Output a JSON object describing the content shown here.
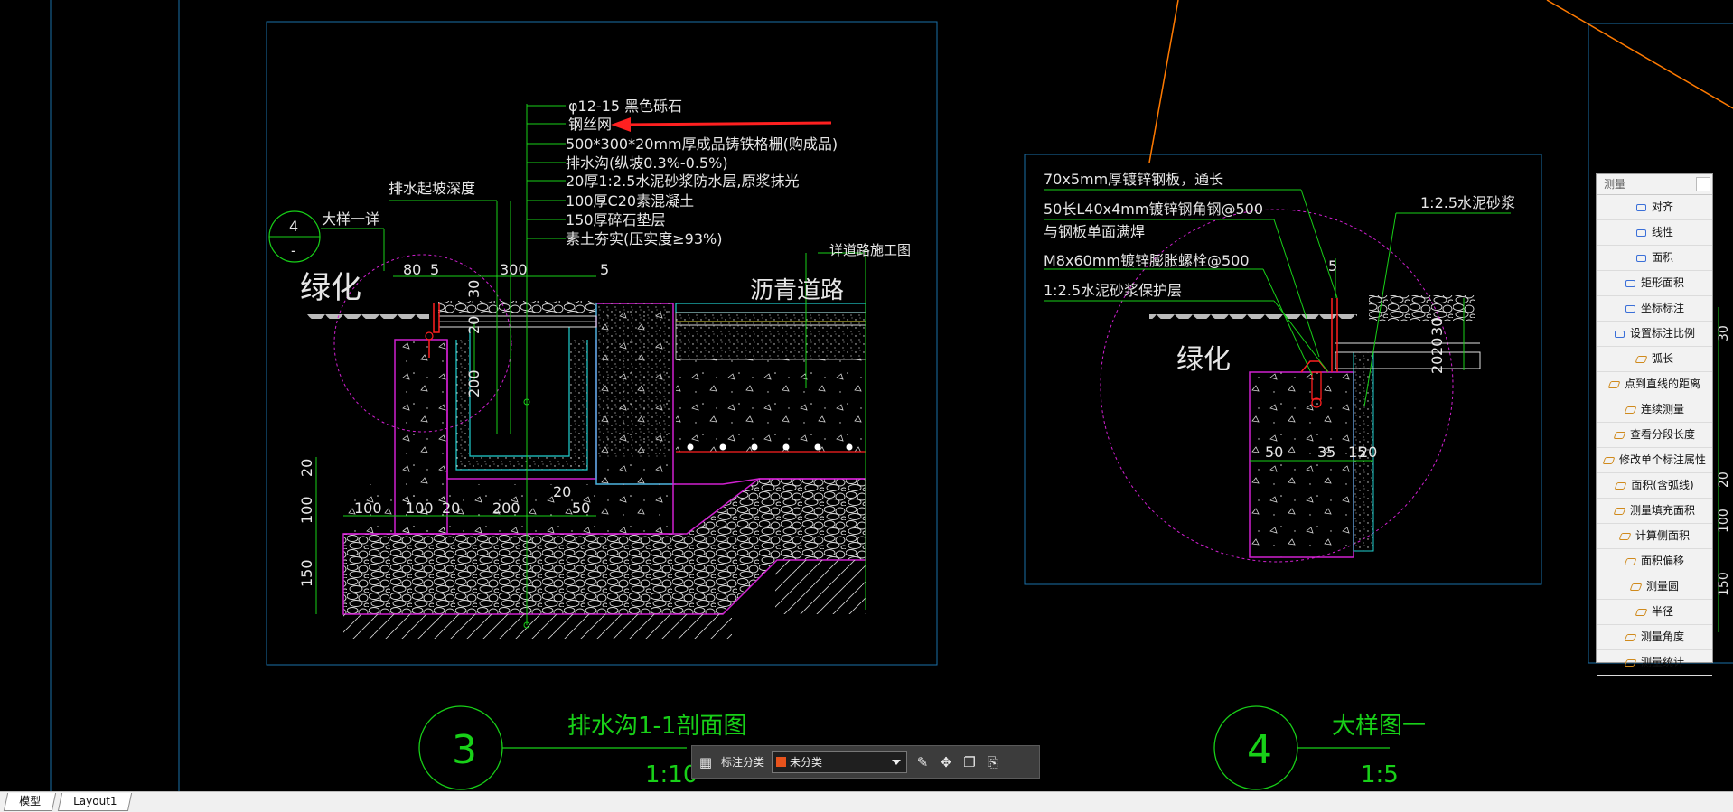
{
  "drawing": {
    "left": {
      "mat_notes": [
        "φ12-15 黑色砾石",
        "钢丝网",
        "500*300*20mm厚成品铸铁格栅(购成品)",
        "排水沟(纵坡0.3%-0.5%)",
        "20厚1:2.5水泥砂浆防水层,原浆抹光",
        "100厚C20素混凝土",
        "150厚碎石垫层",
        "素土夯实(压实度≥93%)"
      ],
      "drain_depth": "排水起坡深度",
      "detail_label": "大样一详",
      "detail_num": "4",
      "detail_dash": "-",
      "green": "绿化",
      "asphalt": "沥青道路",
      "road_ref": "详道路施工图",
      "dims": {
        "d80": "80",
        "d5a": "5",
        "d300": "300",
        "d5b": "5",
        "v30": "30",
        "v20": "20",
        "v200": "200",
        "h100a": "100",
        "h100b": "100",
        "h20a": "20",
        "h200": "200",
        "h20b": "20",
        "h50": "50",
        "l20": "20",
        "l100": "100",
        "l150": "150"
      },
      "title": "排水沟1-1剖面图",
      "scale": "1:10",
      "circle_num": "3"
    },
    "right": {
      "notes": [
        "70x5mm厚镀锌钢板，通长",
        "50长L40x4mm镀锌钢角钢@500",
        "与钢板单面满焊",
        "M8x60mm镀锌膨胀螺栓@500",
        "1:2.5水泥砂浆保护层"
      ],
      "mortar": "1:2.5水泥砂浆",
      "green": "绿化",
      "dims": {
        "t5": "5",
        "v30": "30",
        "v20a": "20",
        "v20b": "20",
        "b50": "50",
        "b35": "35",
        "b15": "15",
        "b20": "20"
      },
      "title": "大样图一",
      "scale": "1:5",
      "circle_num": "4"
    },
    "edge_dims": [
      "30",
      "20",
      "100",
      "150"
    ]
  },
  "measure_panel": {
    "title": "测量",
    "items": [
      "对齐",
      "线性",
      "面积",
      "矩形面积",
      "坐标标注",
      "设置标注比例",
      "弧长",
      "点到直线的距离",
      "连续测量",
      "查看分段长度",
      "修改单个标注属性",
      "面积(含弧线)",
      "测量填充面积",
      "计算侧面积",
      "面积偏移",
      "测量圆",
      "半径",
      "测量角度",
      "测量统计"
    ]
  },
  "toolbar": {
    "label": "标注分类",
    "value": "未分类",
    "swatch_color": "#e8531c"
  },
  "tabs": [
    "模型",
    "Layout1"
  ],
  "colors": {
    "background": "#000000",
    "frame": "#1a6fa8",
    "green_text": "#18d018",
    "magenta": "#d020d0",
    "cyan": "#20d0d0",
    "red": "#ff2020",
    "orange": "#ff7a00"
  }
}
